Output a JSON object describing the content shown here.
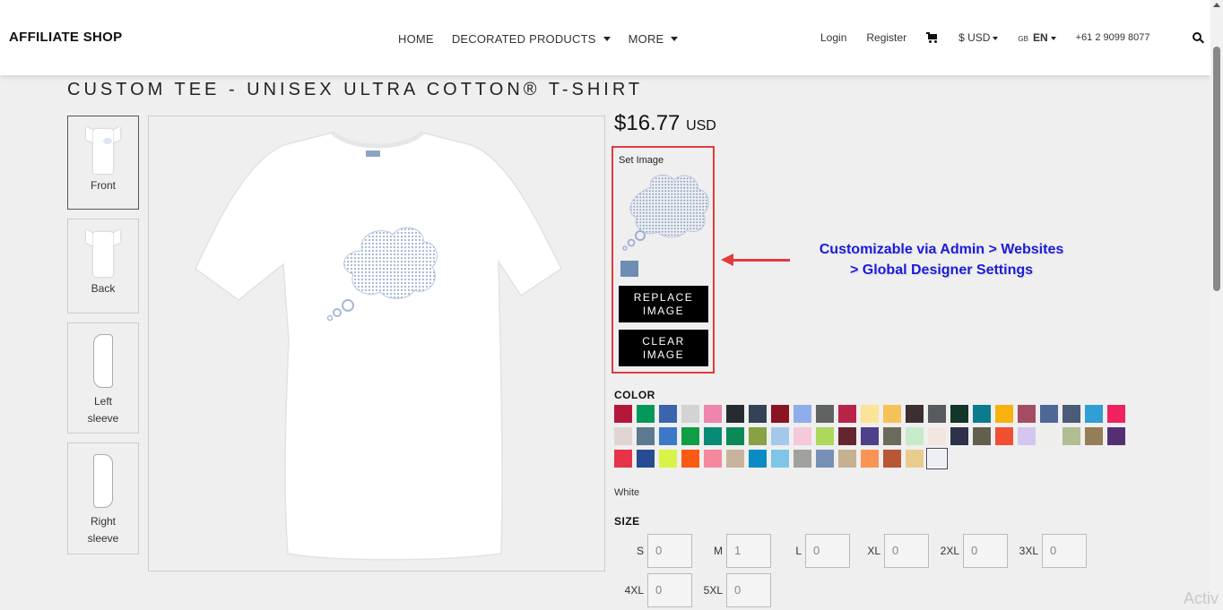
{
  "header": {
    "logo": "AFFILIATE SHOP",
    "nav": [
      "HOME",
      "DECORATED PRODUCTS",
      "MORE"
    ],
    "login": "Login",
    "register": "Register",
    "currency": "$ USD",
    "lang_flag": "GB",
    "lang": "EN",
    "phone": "+61 2 9099 8077"
  },
  "product": {
    "title": "CUSTOM TEE - UNISEX ULTRA COTTON® T-SHIRT",
    "price": "$16.77",
    "currency": "USD",
    "views": [
      "Front",
      "Back",
      "Left sleeve",
      "Right sleeve"
    ]
  },
  "designer": {
    "set_image_label": "Set Image",
    "replace_label": "REPLACE IMAGE",
    "clear_label": "CLEAR IMAGE",
    "swatch_color": "#6e8db3"
  },
  "annotation": {
    "line1": "Customizable via Admin > Websites",
    "line2": "> Global Designer Settings",
    "color": "#1a1ad9"
  },
  "color_section": {
    "label": "COLOR",
    "selected_name": "White",
    "swatches": [
      [
        "#b5173a",
        "#04975a",
        "#3a65ad",
        "#d3d3d3",
        "#ed85ad",
        "#272b31",
        "#334257",
        "#8b1422",
        "#8fadeb",
        "#616262",
        "#b82447",
        "#fbe497",
        "#f5c257",
        "#3d2f2f",
        "#575b5f",
        "#12362a",
        "#0b7c8c",
        "#f8b10e",
        "#a34d63",
        "#4d6896",
        "#4b5b78",
        "#2f9fd4",
        "#f0215f"
      ],
      [
        "#e0d5d3",
        "#5c7a8f",
        "#3c78c8",
        "#0f9e46",
        "#088a76",
        "#0b8a57",
        "#88a143",
        "#a5c8ea",
        "#f5c8db",
        "#acd85b",
        "#632631",
        "#503f8a",
        "#6b6b5b",
        "#c7ebc9",
        "#f3e6e1",
        "#2e3147",
        "#635f4d",
        "#f05031",
        "#d5c6ef",
        "#eeeeec",
        "#b2bd92",
        "#957d56",
        "#543073"
      ],
      [
        "#e53348",
        "#284c93",
        "#dbf346",
        "#fb5a12",
        "#f4889f",
        "#c8b49d",
        "#0a8bc4",
        "#7ec5e8",
        "#a0a09c",
        "#7590b4",
        "#c6b092",
        "#fa9455",
        "#b85636",
        "#e8cc8e",
        "#eceff4"
      ]
    ],
    "selected_index": [
      2,
      14
    ]
  },
  "size_section": {
    "label": "SIZE",
    "sizes": [
      {
        "name": "S",
        "qty": "0"
      },
      {
        "name": "M",
        "qty": "1"
      },
      {
        "name": "L",
        "qty": "0"
      },
      {
        "name": "XL",
        "qty": "0"
      },
      {
        "name": "2XL",
        "qty": "0"
      },
      {
        "name": "3XL",
        "qty": "0"
      },
      {
        "name": "4XL",
        "qty": "0"
      },
      {
        "name": "5XL",
        "qty": "0"
      }
    ]
  },
  "watermark": "Activ"
}
